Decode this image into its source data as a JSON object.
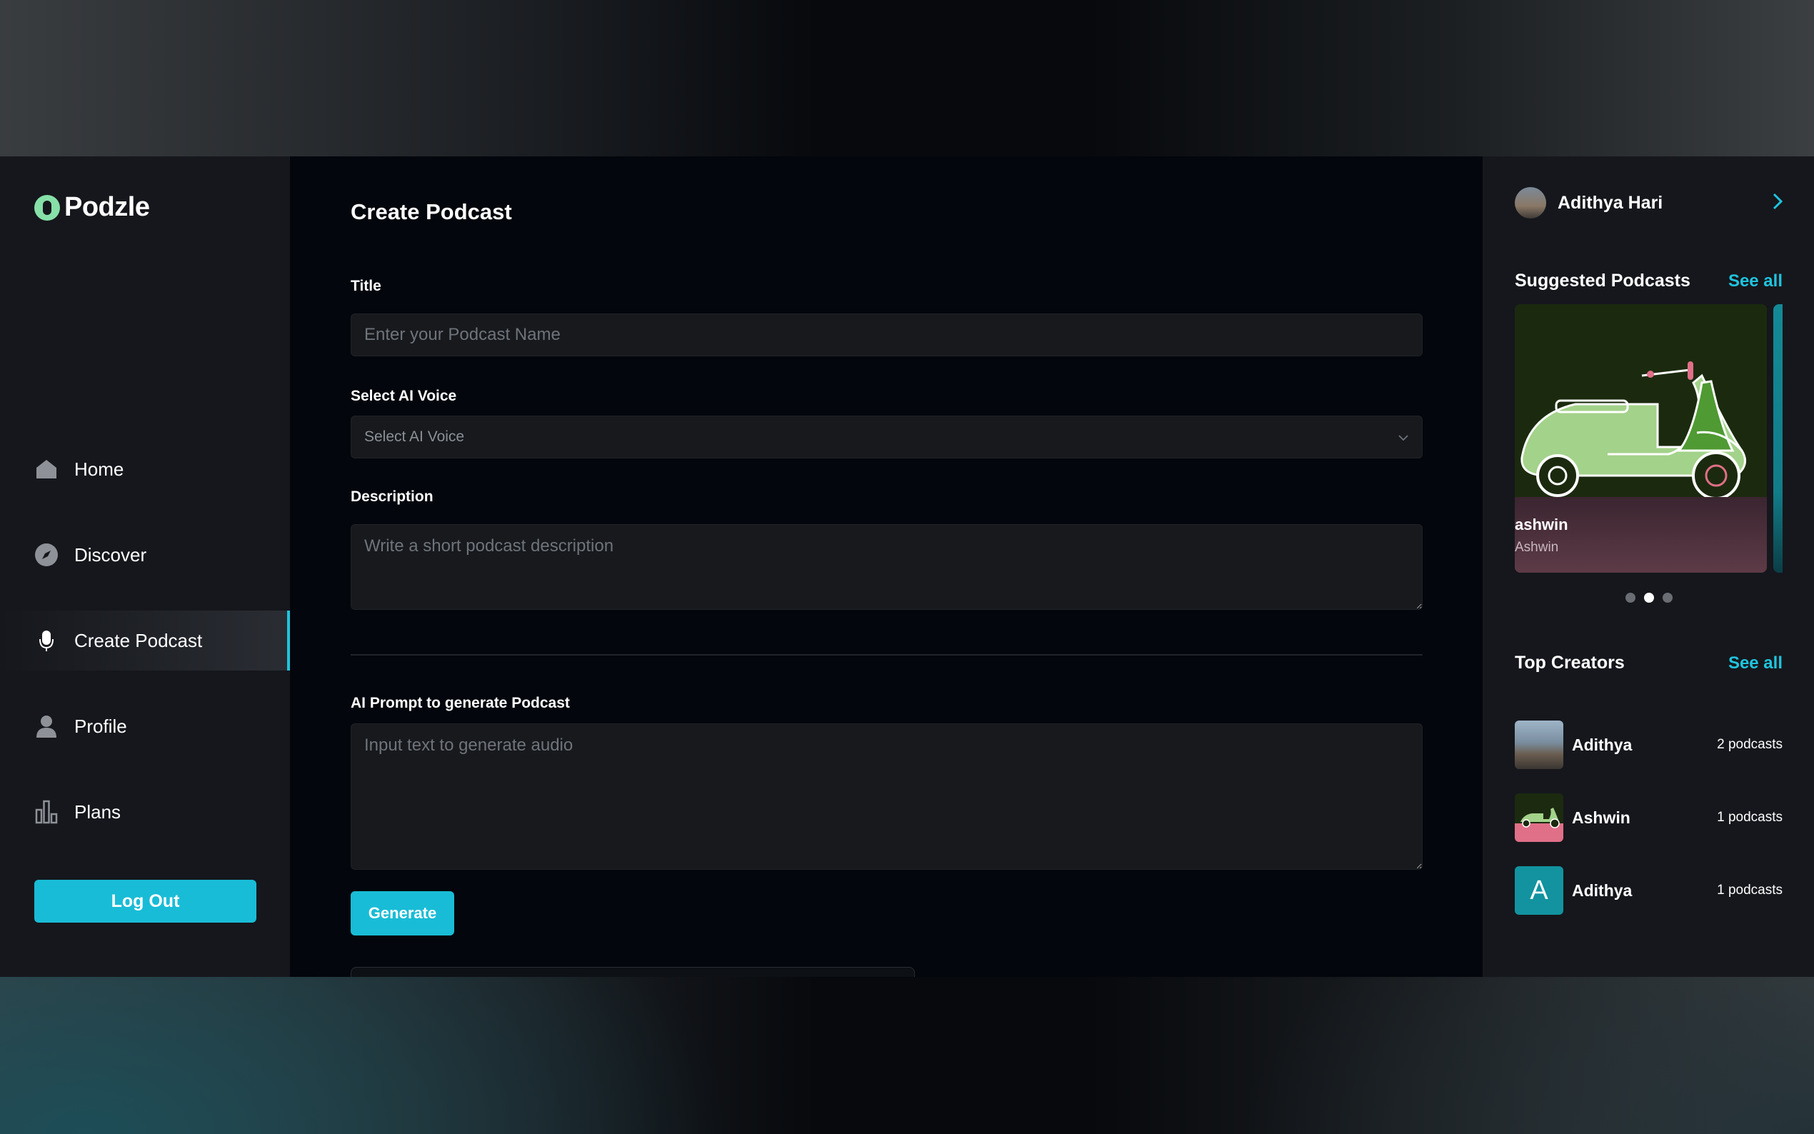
{
  "sidebar": {
    "logo_text": "Podzle",
    "nav_items": [
      {
        "label": "Home",
        "icon": "home-icon"
      },
      {
        "label": "Discover",
        "icon": "compass-icon"
      },
      {
        "label": "Create Podcast",
        "icon": "microphone-icon",
        "active": true
      },
      {
        "label": "Profile",
        "icon": "user-icon"
      },
      {
        "label": "Plans",
        "icon": "bar-chart-icon"
      }
    ],
    "logout_label": "Log Out"
  },
  "main": {
    "page_title": "Create Podcast",
    "title_label": "Title",
    "title_placeholder": "Enter your Podcast Name",
    "voice_label": "Select AI Voice",
    "voice_selected": "Select AI Voice",
    "description_label": "Description",
    "description_placeholder": "Write a short podcast description",
    "prompt_label": "AI Prompt to generate Podcast",
    "prompt_placeholder": "Input text to generate audio",
    "generate_label": "Generate"
  },
  "rightbar": {
    "user_name": "Adithya Hari",
    "suggested_title": "Suggested Podcasts",
    "suggested_see_all": "See all",
    "suggested": [
      {
        "title": "ashwin",
        "author": "Ashwin"
      }
    ],
    "carousel_dots": 3,
    "carousel_active_dot": 1,
    "creators_title": "Top Creators",
    "creators_see_all": "See all",
    "creators": [
      {
        "name": "Adithya",
        "count": "2 podcasts"
      },
      {
        "name": "Ashwin",
        "count": "1 podcasts"
      },
      {
        "name": "Adithya",
        "count": "1 podcasts",
        "initial": "A"
      }
    ]
  },
  "colors": {
    "accent": "#19bcd6",
    "sidebar_bg": "#15171c",
    "main_bg": "#03060c",
    "input_bg": "#17191d"
  }
}
